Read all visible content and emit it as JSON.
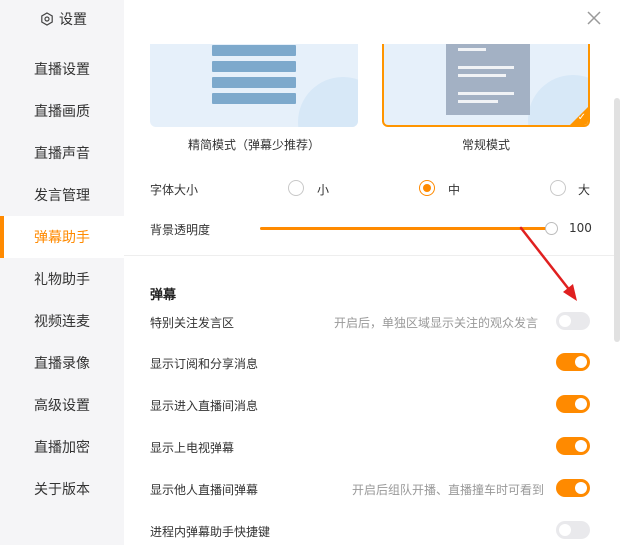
{
  "sidebar": {
    "title": "设置",
    "title_icon": "gear-icon",
    "items": [
      {
        "label": "直播设置",
        "active": false
      },
      {
        "label": "直播画质",
        "active": false
      },
      {
        "label": "直播声音",
        "active": false
      },
      {
        "label": "发言管理",
        "active": false
      },
      {
        "label": "弹幕助手",
        "active": true
      },
      {
        "label": "礼物助手",
        "active": false
      },
      {
        "label": "视频连麦",
        "active": false
      },
      {
        "label": "直播录像",
        "active": false
      },
      {
        "label": "高级设置",
        "active": false
      },
      {
        "label": "直播加密",
        "active": false
      },
      {
        "label": "关于版本",
        "active": false
      }
    ]
  },
  "modes": {
    "simple_label": "精简模式（弹幕少推荐）",
    "normal_label": "常规模式",
    "selected": "normal"
  },
  "font_size": {
    "label": "字体大小",
    "options": [
      "小",
      "中",
      "大"
    ],
    "selected": "中"
  },
  "opacity": {
    "label": "背景透明度",
    "value": 100,
    "value_text": "100"
  },
  "danmaku": {
    "section_title": "弹幕",
    "settings": [
      {
        "label": "特别关注发言区",
        "desc": "开启后，单独区域显示关注的观众发言",
        "on": false
      },
      {
        "label": "显示订阅和分享消息",
        "desc": "",
        "on": true
      },
      {
        "label": "显示进入直播间消息",
        "desc": "",
        "on": true
      },
      {
        "label": "显示上电视弹幕",
        "desc": "",
        "on": true
      },
      {
        "label": "显示他人直播间弹幕",
        "desc": "开启后组队开播、直播撞车时可看到",
        "on": true
      },
      {
        "label": "进程内弹幕助手快捷键",
        "desc": "",
        "on": false
      }
    ]
  },
  "colors": {
    "accent": "#ff8a00",
    "annotation_arrow": "#e02020"
  }
}
